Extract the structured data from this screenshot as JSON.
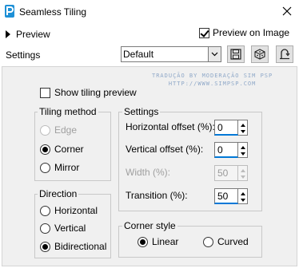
{
  "window": {
    "title": "Seamless Tiling",
    "icon": "app-logo-icon",
    "close_icon": "close-icon"
  },
  "top": {
    "preview_label": "Preview",
    "preview_on_image_label": "Preview on Image",
    "preview_on_image_checked": true,
    "settings_label": "Settings",
    "preset_value": "Default"
  },
  "watermark": {
    "line1": "TRADUÇÃO BY MODERAÇÃO SIM PSP",
    "line2": "HTTP://WWW.SIMPSP.COM"
  },
  "show_tiling_preview_label": "Show tiling preview",
  "show_tiling_preview_checked": false,
  "tiling_method": {
    "title": "Tiling method",
    "options": [
      "Edge",
      "Corner",
      "Mirror"
    ],
    "selected": "Corner",
    "disabled": [
      "Edge"
    ]
  },
  "settings_group": {
    "title": "Settings",
    "horizontal_offset_label": "Horizontal offset (%):",
    "horizontal_offset_value": "0",
    "vertical_offset_label": "Vertical offset (%):",
    "vertical_offset_value": "0",
    "width_label": "Width (%):",
    "width_value": "50",
    "transition_label": "Transition (%):",
    "transition_value": "50"
  },
  "direction": {
    "title": "Direction",
    "options": [
      "Horizontal",
      "Vertical",
      "Bidirectional"
    ],
    "selected": "Bidirectional"
  },
  "corner_style": {
    "title": "Corner style",
    "options": [
      "Linear",
      "Curved"
    ],
    "selected": "Linear"
  }
}
